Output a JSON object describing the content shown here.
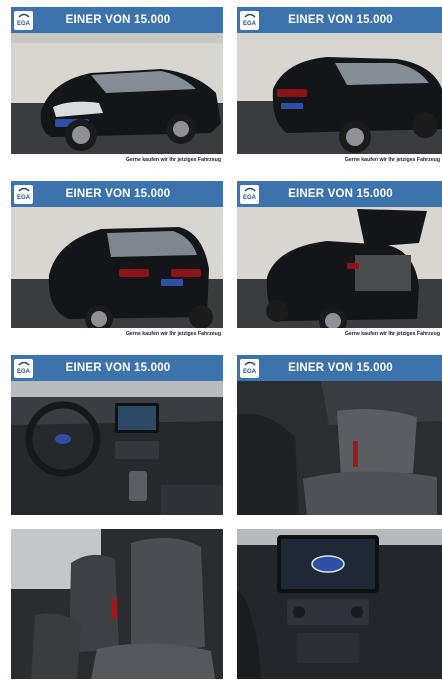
{
  "gallery": {
    "banner_title": "EINER VON 15.000",
    "logo_text": "EGA",
    "footer_text": "Gerne kaufen wir Ihr jetziges Fahrzeug",
    "plate_text": "1 von 15.000",
    "colors": {
      "banner": "#3d73ad",
      "car": "#141518",
      "interior": "#2c2f33"
    },
    "images": [
      {
        "label": "exterior-front-left"
      },
      {
        "label": "exterior-rear-left"
      },
      {
        "label": "exterior-rear-left-2"
      },
      {
        "label": "exterior-rear-trunk-open"
      },
      {
        "label": "interior-dashboard"
      },
      {
        "label": "interior-rear-seats"
      },
      {
        "label": "interior-front-seats"
      },
      {
        "label": "interior-center-console"
      }
    ]
  }
}
